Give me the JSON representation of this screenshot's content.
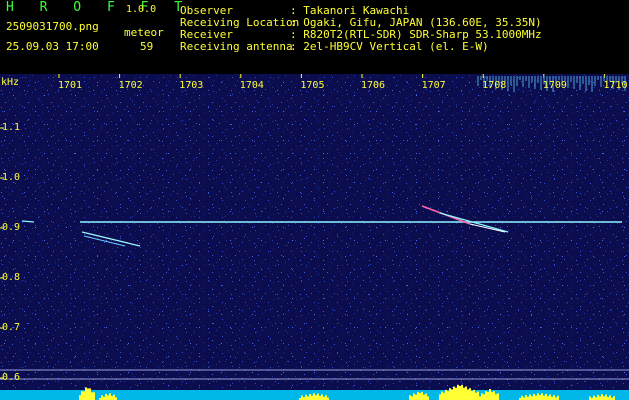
{
  "header": {
    "app_title": "H R O F F T",
    "version": "1.0.0",
    "filename": "2509031700.png",
    "meteor_label": "meteor",
    "datetime": "25.09.03 17:00",
    "meteor_count": "59"
  },
  "info": [
    {
      "key": "Observer",
      "value": ": Takanori Kawachi"
    },
    {
      "key": "Receiving Location",
      "value": ": Ogaki, Gifu, JAPAN (136.60E, 35.35N)"
    },
    {
      "key": "Receiver",
      "value": ": R820T2(RTL-SDR) SDR-Sharp 53.1000MHz"
    },
    {
      "key": "Receiving antenna",
      "value": ": 2el-HB9CV Vertical (el. E-W)"
    }
  ],
  "spectrogram": {
    "y_unit": "kHz",
    "y_ticks": [
      "1.1",
      "1.0",
      "0.9",
      "0.8",
      "0.7",
      "0.6"
    ],
    "x_ticks": [
      "1701",
      "1702",
      "1703",
      "1704",
      "1705",
      "1706",
      "1707",
      "1708",
      "1709",
      "1710"
    ],
    "colors": {
      "background": "#0b0d4e",
      "noise": "#2b4fd8",
      "signal": "#6ef0ff",
      "label": "#ffff33",
      "header": "#3cff3c"
    }
  }
}
